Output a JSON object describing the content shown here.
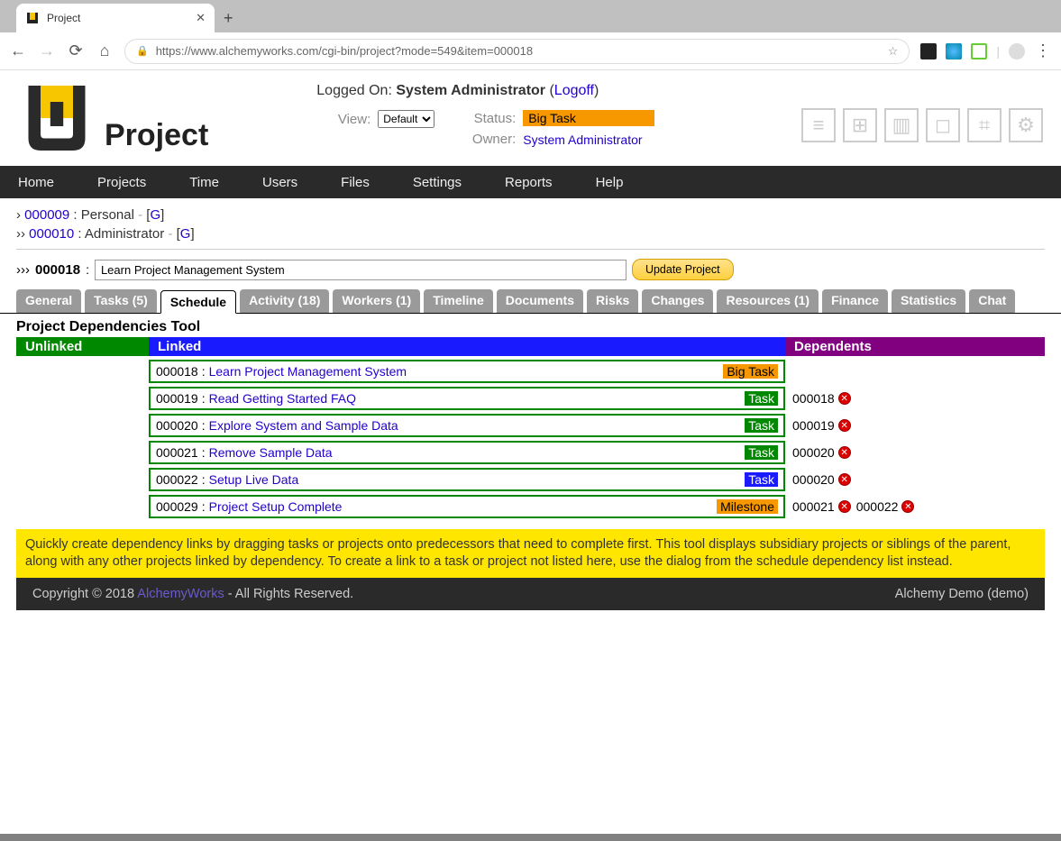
{
  "browser": {
    "tab_title": "Project",
    "url": "https://www.alchemyworks.com/cgi-bin/project?mode=549&item=000018"
  },
  "header": {
    "page_title": "Project",
    "logged_on_label": "Logged On:",
    "user": "System Administrator",
    "logoff": "Logoff",
    "view_label": "View:",
    "view_value": "Default",
    "status_label": "Status:",
    "status_value": "Big Task",
    "owner_label": "Owner:",
    "owner_value": "System Administrator"
  },
  "menu": [
    "Home",
    "Projects",
    "Time",
    "Users",
    "Files",
    "Settings",
    "Reports",
    "Help"
  ],
  "breadcrumbs": [
    {
      "prefix": "›",
      "id": "000009",
      "name": "Personal",
      "g": "G"
    },
    {
      "prefix": "››",
      "id": "000010",
      "name": "Administrator",
      "g": "G"
    }
  ],
  "project": {
    "prefix": "›››",
    "id": "000018",
    "name": "Learn Project Management System",
    "update_label": "Update Project"
  },
  "tabs": [
    "General",
    "Tasks (5)",
    "Schedule",
    "Activity (18)",
    "Workers (1)",
    "Timeline",
    "Documents",
    "Risks",
    "Changes",
    "Resources (1)",
    "Finance",
    "Statistics",
    "Chat"
  ],
  "active_tab": "Schedule",
  "tool_title": "Project Dependencies Tool",
  "columns": {
    "unlinked": "Unlinked",
    "linked": "Linked",
    "dependents": "Dependents"
  },
  "linked": [
    {
      "id": "000018",
      "name": "Learn Project Management System",
      "tag": "Big Task",
      "tag_class": "tag-bigtask",
      "deps": []
    },
    {
      "id": "000019",
      "name": "Read Getting Started FAQ",
      "tag": "Task",
      "tag_class": "tag-task",
      "deps": [
        "000018"
      ]
    },
    {
      "id": "000020",
      "name": "Explore System and Sample Data",
      "tag": "Task",
      "tag_class": "tag-task",
      "deps": [
        "000019"
      ]
    },
    {
      "id": "000021",
      "name": "Remove Sample Data",
      "tag": "Task",
      "tag_class": "tag-task",
      "deps": [
        "000020"
      ]
    },
    {
      "id": "000022",
      "name": "Setup Live Data",
      "tag": "Task",
      "tag_class": "tag-task-blue",
      "deps": [
        "000020"
      ]
    },
    {
      "id": "000029",
      "name": "Project Setup Complete",
      "tag": "Milestone",
      "tag_class": "tag-milestone",
      "deps": [
        "000021",
        "000022"
      ]
    }
  ],
  "help_text": "Quickly create dependency links by dragging tasks or projects onto predecessors that need to complete first. This tool displays subsidiary projects or siblings of the parent, along with any other projects linked by dependency. To create a link to a task or project not listed here, use the dialog from the schedule dependency list instead.",
  "footer": {
    "copyright": "Copyright © 2018 ",
    "brand": "AlchemyWorks",
    "rights": " - All Rights Reserved.",
    "right": "Alchemy Demo (demo)"
  }
}
